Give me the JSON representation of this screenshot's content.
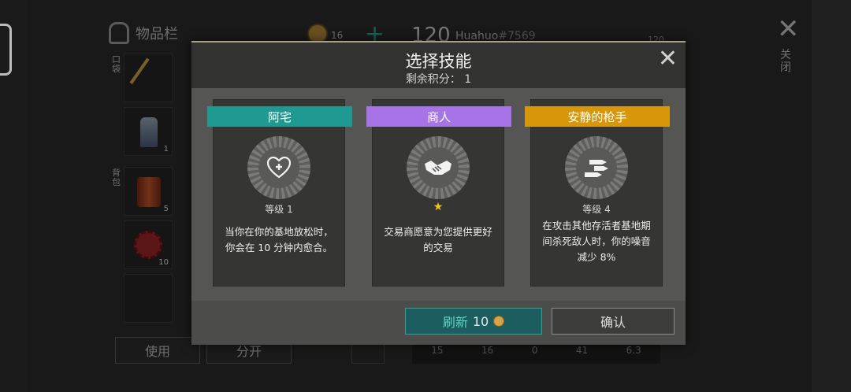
{
  "background": {
    "inventory_title": "物品栏",
    "coin_count": "16",
    "level": "120",
    "player_name": "Huahuo",
    "player_id": "#7569",
    "right_number": "120",
    "side_label_pocket": "口袋",
    "side_label_backpack": "背包",
    "slots": [
      {
        "icon": "pickaxe-icon",
        "qty": ""
      },
      {
        "icon": "spray-can-icon",
        "qty": "1"
      },
      {
        "icon": "food-can-icon",
        "qty": "5"
      },
      {
        "icon": "bottle-cap-icon",
        "qty": "10"
      }
    ],
    "use_button": "使用",
    "split_button": "分开",
    "stats": [
      "15",
      "16",
      "0",
      "41",
      "6.3"
    ],
    "close_vertical_label": "关闭"
  },
  "dialog": {
    "title": "选择技能",
    "subtitle": "剩余积分： 1",
    "cards": [
      {
        "name": "阿宅",
        "ribbon_color": "#1f9a93",
        "icon": "heart-plus-icon",
        "level": "等级 1",
        "description": "当你在你的基地放松时，你会在 10 分钟内愈合。"
      },
      {
        "name": "商人",
        "ribbon_color": "#a774e8",
        "icon": "handshake-icon",
        "star": "★",
        "description": "交易商愿意为您提供更好的交易"
      },
      {
        "name": "安静的枪手",
        "ribbon_color": "#d8970a",
        "icon": "bullets-icon",
        "level": "等级 4",
        "description": "在攻击其他存活者基地期间杀死敌人时，你的噪音减少 8%"
      }
    ],
    "refresh_label": "刷新",
    "refresh_cost": "10",
    "confirm_label": "确认"
  }
}
